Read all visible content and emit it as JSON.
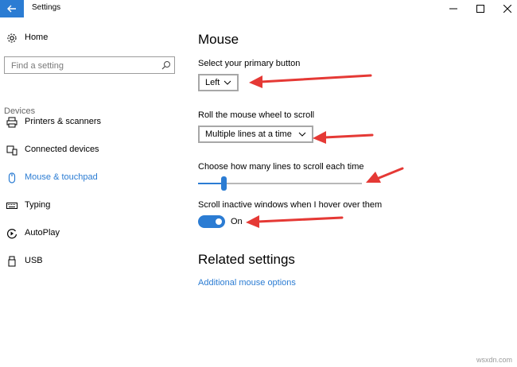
{
  "window": {
    "title": "Settings"
  },
  "sidebar": {
    "home_label": "Home",
    "search_placeholder": "Find a setting",
    "section_header": "Devices",
    "items": [
      {
        "label": "Printers & scanners",
        "icon": "printer-icon"
      },
      {
        "label": "Connected devices",
        "icon": "devices-icon"
      },
      {
        "label": "Mouse & touchpad",
        "icon": "mouse-icon",
        "active": true
      },
      {
        "label": "Typing",
        "icon": "keyboard-icon"
      },
      {
        "label": "AutoPlay",
        "icon": "autoplay-icon"
      },
      {
        "label": "USB",
        "icon": "usb-icon"
      }
    ]
  },
  "main": {
    "title": "Mouse",
    "primary_button": {
      "label": "Select your primary button",
      "value": "Left"
    },
    "wheel_scroll": {
      "label": "Roll the mouse wheel to scroll",
      "value": "Multiple lines at a time"
    },
    "lines_to_scroll": {
      "label": "Choose how many lines to scroll each time",
      "level": 0.16
    },
    "inactive_scroll": {
      "label": "Scroll inactive windows when I hover over them",
      "state": "On"
    },
    "related_title": "Related settings",
    "related_link": "Additional mouse options"
  },
  "watermark": "wsxdn.com",
  "colors": {
    "accent": "#2b7cd3",
    "annotation_arrow": "#e53935"
  }
}
